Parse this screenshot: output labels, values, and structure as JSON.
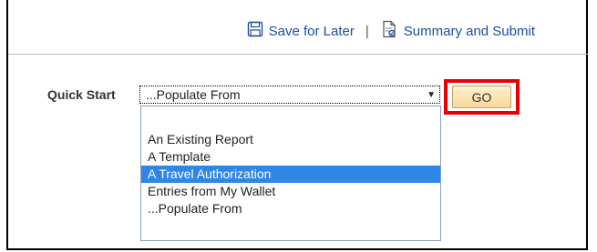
{
  "toolbar": {
    "save_label": "Save for Later",
    "separator": "|",
    "summary_label": "Summary and Submit",
    "link_color": "#1a4fa0"
  },
  "quick_start": {
    "label": "Quick Start",
    "selected_value": "...Populate From",
    "go_label": "GO",
    "options": [
      "An Existing Report",
      "A Template",
      "A Travel Authorization",
      "Entries from My Wallet",
      "...Populate From"
    ],
    "highlighted_option": "A Travel Authorization",
    "highlight_color": "#2f86e6",
    "callout_color": "#e60000"
  }
}
